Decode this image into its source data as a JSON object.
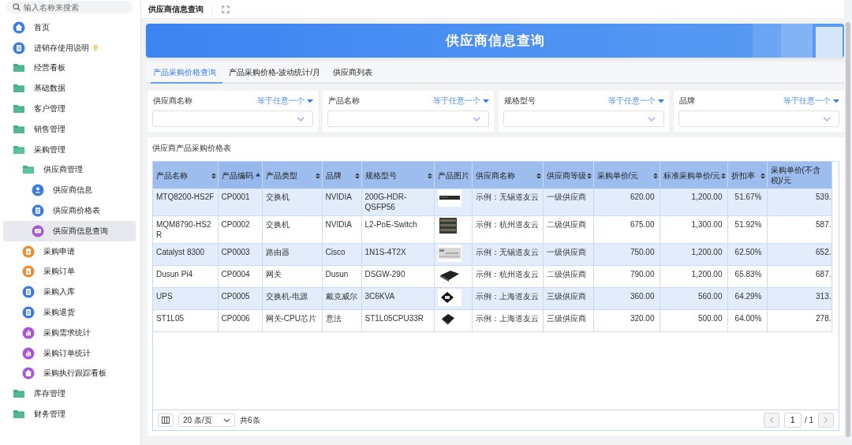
{
  "sidebar": {
    "search": {
      "placeholder": "输入名称来搜索"
    },
    "items": [
      {
        "label": "首页",
        "kind": "home",
        "selected": false
      },
      {
        "label": "进销存使用说明",
        "kind": "guide",
        "selected": false
      },
      {
        "label": "经营看板",
        "kind": "folder",
        "expanded": false,
        "selected": false
      },
      {
        "label": "基础数据",
        "kind": "folder",
        "expanded": false,
        "selected": false
      },
      {
        "label": "客户管理",
        "kind": "folder",
        "expanded": false,
        "selected": false
      },
      {
        "label": "销售管理",
        "kind": "folder",
        "expanded": false,
        "selected": false
      },
      {
        "label": "采购管理",
        "kind": "folder",
        "expanded": true,
        "selected": false,
        "children": [
          {
            "label": "供应商管理",
            "kind": "folder",
            "expanded": true,
            "selected": false,
            "children": [
              {
                "label": "供应商信息",
                "kind": "user",
                "selected": false
              },
              {
                "label": "供应商价格表",
                "kind": "doc",
                "selected": false
              },
              {
                "label": "供应商信息查询",
                "kind": "screen",
                "selected": true
              }
            ]
          },
          {
            "label": "采购申请",
            "kind": "clipboard",
            "selected": false
          },
          {
            "label": "采购订单",
            "kind": "clipboard",
            "selected": false
          },
          {
            "label": "采购入库",
            "kind": "doc",
            "selected": false
          },
          {
            "label": "采购退货",
            "kind": "doc",
            "selected": false
          },
          {
            "label": "采购需求统计",
            "kind": "chart",
            "selected": false
          },
          {
            "label": "采购订单统计",
            "kind": "chart",
            "selected": false
          },
          {
            "label": "采购执行跟踪看板",
            "kind": "dashboard",
            "selected": false
          }
        ]
      },
      {
        "label": "库存管理",
        "kind": "folder",
        "expanded": false,
        "selected": false
      },
      {
        "label": "财务管理",
        "kind": "folder",
        "expanded": false,
        "selected": false
      }
    ]
  },
  "header": {
    "title": "供应商信息查询"
  },
  "banner": {
    "title": "供应商信息查询"
  },
  "tabs": [
    {
      "label": "产品采购价格查询",
      "selected": true
    },
    {
      "label": "产品采购价格-波动统计/月",
      "selected": false
    },
    {
      "label": "供应商列表",
      "selected": false
    }
  ],
  "filters": [
    {
      "label": "供应商名称",
      "operator": "等于任意一个"
    },
    {
      "label": "产品名称",
      "operator": "等于任意一个"
    },
    {
      "label": "规格型号",
      "operator": "等于任意一个"
    },
    {
      "label": "品牌",
      "operator": "等于任意一个"
    }
  ],
  "table": {
    "title": "供应商产品采购价格表",
    "columns": [
      {
        "label": "产品名称",
        "sortable": true,
        "sorted": false
      },
      {
        "label": "产品编码",
        "sortable": true,
        "sorted": true
      },
      {
        "label": "产品类型",
        "sortable": true,
        "sorted": false
      },
      {
        "label": "品牌",
        "sortable": true,
        "sorted": false
      },
      {
        "label": "规格型号",
        "sortable": true,
        "sorted": false
      },
      {
        "label": "产品图片",
        "sortable": false
      },
      {
        "label": "供应商名称",
        "sortable": true,
        "sorted": false
      },
      {
        "label": "供应商等级",
        "sortable": true,
        "sorted": false
      },
      {
        "label": "采购单价/元",
        "sortable": true,
        "sorted": false
      },
      {
        "label": "标准采购单价/元",
        "sortable": true,
        "sorted": false
      },
      {
        "label": "折扣率",
        "sortable": true,
        "sorted": false
      },
      {
        "label": "采购单价(不含税)/元",
        "sortable": false
      }
    ],
    "rows": [
      {
        "cells": [
          "MTQ8200-HS2F",
          "CP0001",
          "交换机",
          "NVIDIA",
          "200G-HDR-QSFP56",
          {
            "kind": "picture"
          },
          "示例：无锡道友云",
          "一级供应商",
          "620.00",
          "1,200.00",
          "51.67%",
          "539."
        ]
      },
      {
        "cells": [
          "MQM8790-HS2R",
          "CP0002",
          "交换机",
          "NVIDIA",
          "L2-PoE-Switch",
          {
            "kind": "picture"
          },
          "示例：杭州道友云",
          "二级供应商",
          "675.00",
          "1,300.00",
          "51.92%",
          "587."
        ]
      },
      {
        "cells": [
          "Catalyst 8300",
          "CP0003",
          "路由器",
          "Cisco",
          "1N1S-4T2X",
          {
            "kind": "picture"
          },
          "示例：无锡道友云",
          "一级供应商",
          "750.00",
          "1,200.00",
          "62.50%",
          "652."
        ]
      },
      {
        "cells": [
          "Dusun Pi4",
          "CP0004",
          "网关",
          "Dusun",
          "DSGW-290",
          {
            "kind": "picture"
          },
          "示例：杭州道友云",
          "二级供应商",
          "790.00",
          "1,200.00",
          "65.83%",
          "687."
        ]
      },
      {
        "cells": [
          "UPS",
          "CP0005",
          "交换机-电源",
          "戴克威尔",
          "3C6KVA",
          {
            "kind": "picture"
          },
          "示例：上海道友云",
          "三级供应商",
          "360.00",
          "560.00",
          "64.29%",
          "313."
        ]
      },
      {
        "cells": [
          "ST1L05",
          "CP0006",
          "网关-CPU芯片",
          "意法",
          "ST1L05CPU33R",
          {
            "kind": "picture"
          },
          "示例：上海道友云",
          "三级供应商",
          "320.00",
          "500.00",
          "64.00%",
          "278."
        ]
      }
    ]
  },
  "pagination": {
    "page_size": "20 条/页",
    "total": "共6条",
    "page": "1",
    "pages": "/ 1",
    "prev_disabled": true,
    "next_disabled": true
  }
}
